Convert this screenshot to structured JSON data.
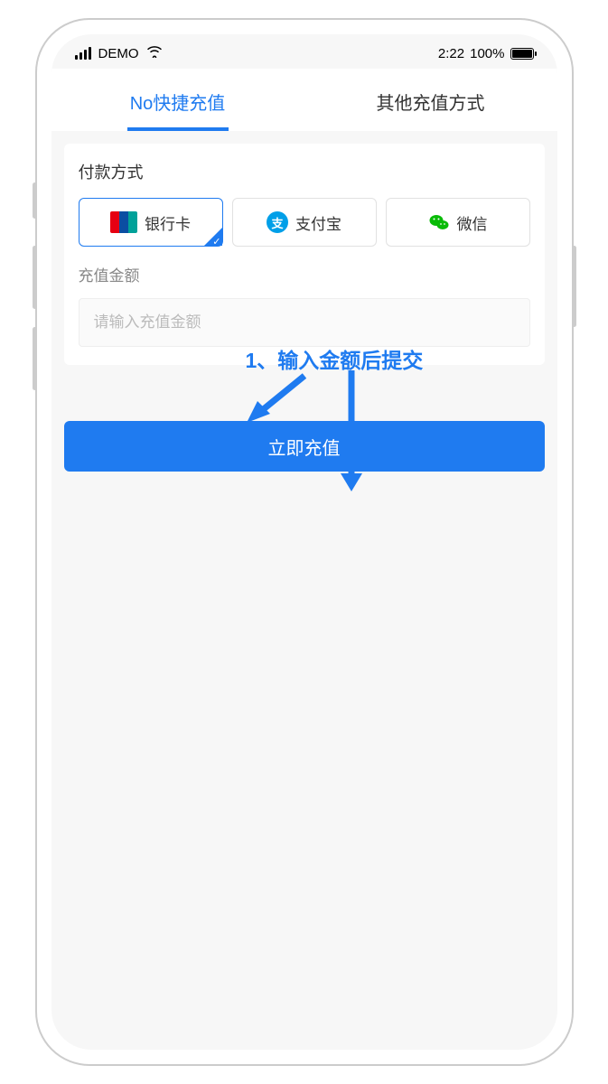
{
  "statusBar": {
    "carrier": "DEMO",
    "time": "2:22",
    "batteryPct": "100%"
  },
  "tabs": {
    "quick": "No快捷充值",
    "other": "其他充值方式"
  },
  "labels": {
    "payMethod": "付款方式",
    "amount": "充值金额"
  },
  "payMethods": {
    "bankCard": "银行卡",
    "alipay": "支付宝",
    "wechat": "微信"
  },
  "amountInput": {
    "placeholder": "请输入充值金额"
  },
  "submit": "立即充值",
  "annotation": "1、输入金额后提交"
}
